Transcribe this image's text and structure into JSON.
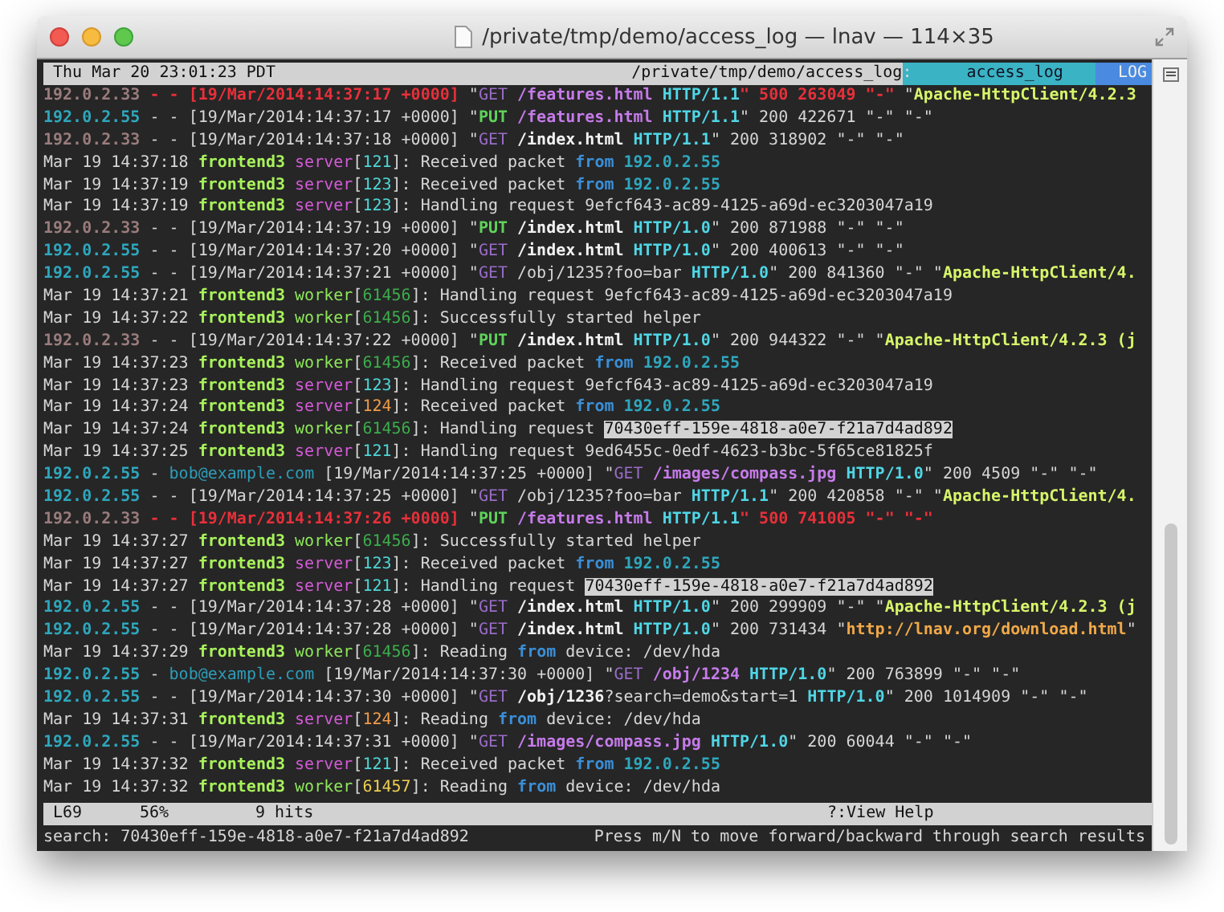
{
  "window": {
    "title": "/private/tmp/demo/access_log — lnav — 114×35"
  },
  "top_bar": {
    "clock": "Thu Mar 20 23:01:23 PDT",
    "path": "/private/tmp/demo/access_log",
    "separator": ":",
    "file": "access_log",
    "view": "LOG"
  },
  "log_lines": [
    [
      {
        "kind": "ip-dim",
        "text": "192.0.2.33"
      },
      {
        "kind": "error",
        "text": " - - [19/Mar/2014:14:37:17 +0000]"
      },
      {
        "kind": "plain",
        "text": " \""
      },
      {
        "kind": "get",
        "text": "GET"
      },
      {
        "kind": "path",
        "text": " /features.html"
      },
      {
        "kind": "proto",
        "text": " HTTP/1.1"
      },
      {
        "kind": "error",
        "text": "\" 500 263049 \"-\" "
      },
      {
        "kind": "plain",
        "text": "\""
      },
      {
        "kind": "agent",
        "text": "Apache-HttpClient/4.2.3"
      }
    ],
    [
      {
        "kind": "ip",
        "text": "192.0.2.55"
      },
      {
        "kind": "plain",
        "text": " - - [19/Mar/2014:14:37:17 +0000] \""
      },
      {
        "kind": "put",
        "text": "PUT"
      },
      {
        "kind": "path",
        "text": " /features.html"
      },
      {
        "kind": "proto",
        "text": " HTTP/1.1"
      },
      {
        "kind": "plain",
        "text": "\" 200 422671 \"-\" \"-\""
      }
    ],
    [
      {
        "kind": "ip-dim",
        "text": "192.0.2.33"
      },
      {
        "kind": "plain",
        "text": " - - [19/Mar/2014:14:37:18 +0000] \""
      },
      {
        "kind": "get",
        "text": "GET"
      },
      {
        "kind": "file",
        "text": " /index.html"
      },
      {
        "kind": "proto",
        "text": " HTTP/1.1"
      },
      {
        "kind": "plain",
        "text": "\" 200 318902 \"-\" \"-\""
      }
    ],
    [
      {
        "kind": "plain",
        "text": "Mar 19 14:37:18 "
      },
      {
        "kind": "host",
        "text": "frontend3"
      },
      {
        "kind": "server",
        "text": " server"
      },
      {
        "kind": "plain",
        "text": "["
      },
      {
        "kind": "pid-cyan",
        "text": "121"
      },
      {
        "kind": "plain",
        "text": "]: Received packet "
      },
      {
        "kind": "from",
        "text": "from"
      },
      {
        "kind": "ip",
        "text": " 192.0.2.55"
      }
    ],
    [
      {
        "kind": "plain",
        "text": "Mar 19 14:37:19 "
      },
      {
        "kind": "host",
        "text": "frontend3"
      },
      {
        "kind": "server",
        "text": " server"
      },
      {
        "kind": "plain",
        "text": "["
      },
      {
        "kind": "pid-cyan",
        "text": "123"
      },
      {
        "kind": "plain",
        "text": "]: Received packet "
      },
      {
        "kind": "from",
        "text": "from"
      },
      {
        "kind": "ip",
        "text": " 192.0.2.55"
      }
    ],
    [
      {
        "kind": "plain",
        "text": "Mar 19 14:37:19 "
      },
      {
        "kind": "host",
        "text": "frontend3"
      },
      {
        "kind": "server",
        "text": " server"
      },
      {
        "kind": "plain",
        "text": "["
      },
      {
        "kind": "pid-cyan",
        "text": "123"
      },
      {
        "kind": "plain",
        "text": "]: Handling request 9efcf643-ac89-4125-a69d-ec3203047a19"
      }
    ],
    [
      {
        "kind": "ip-dim",
        "text": "192.0.2.33"
      },
      {
        "kind": "plain",
        "text": " - - [19/Mar/2014:14:37:19 +0000] \""
      },
      {
        "kind": "put",
        "text": "PUT"
      },
      {
        "kind": "file",
        "text": " /index.html"
      },
      {
        "kind": "proto",
        "text": " HTTP/1.0"
      },
      {
        "kind": "plain",
        "text": "\" 200 871988 \"-\" \"-\""
      }
    ],
    [
      {
        "kind": "ip",
        "text": "192.0.2.55"
      },
      {
        "kind": "plain",
        "text": " - - [19/Mar/2014:14:37:20 +0000] \""
      },
      {
        "kind": "get",
        "text": "GET"
      },
      {
        "kind": "file",
        "text": " /index.html"
      },
      {
        "kind": "proto",
        "text": " HTTP/1.0"
      },
      {
        "kind": "plain",
        "text": "\" 200 400613 \"-\" \"-\""
      }
    ],
    [
      {
        "kind": "ip",
        "text": "192.0.2.55"
      },
      {
        "kind": "plain",
        "text": " - - [19/Mar/2014:14:37:21 +0000] \""
      },
      {
        "kind": "get",
        "text": "GET"
      },
      {
        "kind": "plain",
        "text": " /obj/1235?foo=bar"
      },
      {
        "kind": "proto",
        "text": " HTTP/1.0"
      },
      {
        "kind": "plain",
        "text": "\" 200 841360 \"-\" \""
      },
      {
        "kind": "agent",
        "text": "Apache-HttpClient/4."
      }
    ],
    [
      {
        "kind": "plain",
        "text": "Mar 19 14:37:21 "
      },
      {
        "kind": "host",
        "text": "frontend3"
      },
      {
        "kind": "worker",
        "text": " worker"
      },
      {
        "kind": "plain",
        "text": "["
      },
      {
        "kind": "pid-green",
        "text": "61456"
      },
      {
        "kind": "plain",
        "text": "]: Handling request 9efcf643-ac89-4125-a69d-ec3203047a19"
      }
    ],
    [
      {
        "kind": "plain",
        "text": "Mar 19 14:37:22 "
      },
      {
        "kind": "host",
        "text": "frontend3"
      },
      {
        "kind": "worker",
        "text": " worker"
      },
      {
        "kind": "plain",
        "text": "["
      },
      {
        "kind": "pid-green",
        "text": "61456"
      },
      {
        "kind": "plain",
        "text": "]: Successfully started helper"
      }
    ],
    [
      {
        "kind": "ip-dim",
        "text": "192.0.2.33"
      },
      {
        "kind": "plain",
        "text": " - - [19/Mar/2014:14:37:22 +0000] \""
      },
      {
        "kind": "put",
        "text": "PUT"
      },
      {
        "kind": "file",
        "text": " /index.html"
      },
      {
        "kind": "proto",
        "text": " HTTP/1.0"
      },
      {
        "kind": "plain",
        "text": "\" 200 944322 \"-\" \""
      },
      {
        "kind": "agent",
        "text": "Apache-HttpClient/4.2.3 (j"
      }
    ],
    [
      {
        "kind": "plain",
        "text": "Mar 19 14:37:23 "
      },
      {
        "kind": "host",
        "text": "frontend3"
      },
      {
        "kind": "worker",
        "text": " worker"
      },
      {
        "kind": "plain",
        "text": "["
      },
      {
        "kind": "pid-green",
        "text": "61456"
      },
      {
        "kind": "plain",
        "text": "]: Received packet "
      },
      {
        "kind": "from",
        "text": "from"
      },
      {
        "kind": "ip",
        "text": " 192.0.2.55"
      }
    ],
    [
      {
        "kind": "plain",
        "text": "Mar 19 14:37:23 "
      },
      {
        "kind": "host",
        "text": "frontend3"
      },
      {
        "kind": "server",
        "text": " server"
      },
      {
        "kind": "plain",
        "text": "["
      },
      {
        "kind": "pid-cyan",
        "text": "123"
      },
      {
        "kind": "plain",
        "text": "]: Handling request 9efcf643-ac89-4125-a69d-ec3203047a19"
      }
    ],
    [
      {
        "kind": "plain",
        "text": "Mar 19 14:37:24 "
      },
      {
        "kind": "host",
        "text": "frontend3"
      },
      {
        "kind": "server",
        "text": " server"
      },
      {
        "kind": "plain",
        "text": "["
      },
      {
        "kind": "pid-orange",
        "text": "124"
      },
      {
        "kind": "plain",
        "text": "]: Received packet "
      },
      {
        "kind": "from",
        "text": "from"
      },
      {
        "kind": "ip",
        "text": " 192.0.2.55"
      }
    ],
    [
      {
        "kind": "plain",
        "text": "Mar 19 14:37:24 "
      },
      {
        "kind": "host",
        "text": "frontend3"
      },
      {
        "kind": "worker",
        "text": " worker"
      },
      {
        "kind": "plain",
        "text": "["
      },
      {
        "kind": "pid-green",
        "text": "61456"
      },
      {
        "kind": "plain",
        "text": "]: Handling request "
      },
      {
        "kind": "match",
        "text": "70430eff-159e-4818-a0e7-f21a7d4ad892"
      }
    ],
    [
      {
        "kind": "plain",
        "text": "Mar 19 14:37:25 "
      },
      {
        "kind": "host",
        "text": "frontend3"
      },
      {
        "kind": "server",
        "text": " server"
      },
      {
        "kind": "plain",
        "text": "["
      },
      {
        "kind": "pid-cyan",
        "text": "121"
      },
      {
        "kind": "plain",
        "text": "]: Handling request 9ed6455c-0edf-4623-b3bc-5f65ce81825f"
      }
    ],
    [
      {
        "kind": "ip",
        "text": "192.0.2.55"
      },
      {
        "kind": "plain",
        "text": " - "
      },
      {
        "kind": "user",
        "text": "bob@example.com"
      },
      {
        "kind": "plain",
        "text": " [19/Mar/2014:14:37:25 +0000] \""
      },
      {
        "kind": "get",
        "text": "GET"
      },
      {
        "kind": "path",
        "text": " /images/compass.jpg"
      },
      {
        "kind": "proto",
        "text": " HTTP/1.0"
      },
      {
        "kind": "plain",
        "text": "\" 200 4509 \"-\" \"-\""
      }
    ],
    [
      {
        "kind": "ip",
        "text": "192.0.2.55"
      },
      {
        "kind": "plain",
        "text": " - - [19/Mar/2014:14:37:25 +0000] \""
      },
      {
        "kind": "get",
        "text": "GET"
      },
      {
        "kind": "plain",
        "text": " /obj/1235?foo=bar"
      },
      {
        "kind": "proto",
        "text": " HTTP/1.1"
      },
      {
        "kind": "plain",
        "text": "\" 200 420858 \"-\" \""
      },
      {
        "kind": "agent",
        "text": "Apache-HttpClient/4."
      }
    ],
    [
      {
        "kind": "ip-dim",
        "text": "192.0.2.33"
      },
      {
        "kind": "error",
        "text": " - - [19/Mar/2014:14:37:26 +0000]"
      },
      {
        "kind": "plain",
        "text": " \""
      },
      {
        "kind": "put",
        "text": "PUT"
      },
      {
        "kind": "path",
        "text": " /features.html"
      },
      {
        "kind": "proto",
        "text": " HTTP/1.1"
      },
      {
        "kind": "error",
        "text": "\" 500 741005 \"-\" \"-\""
      }
    ],
    [
      {
        "kind": "plain",
        "text": "Mar 19 14:37:27 "
      },
      {
        "kind": "host",
        "text": "frontend3"
      },
      {
        "kind": "worker",
        "text": " worker"
      },
      {
        "kind": "plain",
        "text": "["
      },
      {
        "kind": "pid-green",
        "text": "61456"
      },
      {
        "kind": "plain",
        "text": "]: Successfully started helper"
      }
    ],
    [
      {
        "kind": "plain",
        "text": "Mar 19 14:37:27 "
      },
      {
        "kind": "host",
        "text": "frontend3"
      },
      {
        "kind": "server",
        "text": " server"
      },
      {
        "kind": "plain",
        "text": "["
      },
      {
        "kind": "pid-cyan",
        "text": "123"
      },
      {
        "kind": "plain",
        "text": "]: Received packet "
      },
      {
        "kind": "from",
        "text": "from"
      },
      {
        "kind": "ip",
        "text": " 192.0.2.55"
      }
    ],
    [
      {
        "kind": "plain",
        "text": "Mar 19 14:37:27 "
      },
      {
        "kind": "host",
        "text": "frontend3"
      },
      {
        "kind": "server",
        "text": " server"
      },
      {
        "kind": "plain",
        "text": "["
      },
      {
        "kind": "pid-cyan",
        "text": "121"
      },
      {
        "kind": "plain",
        "text": "]: Handling request "
      },
      {
        "kind": "match",
        "text": "70430eff-159e-4818-a0e7-f21a7d4ad892"
      }
    ],
    [
      {
        "kind": "ip",
        "text": "192.0.2.55"
      },
      {
        "kind": "plain",
        "text": " - - [19/Mar/2014:14:37:28 +0000] \""
      },
      {
        "kind": "get",
        "text": "GET"
      },
      {
        "kind": "file",
        "text": " /index.html"
      },
      {
        "kind": "proto",
        "text": " HTTP/1.0"
      },
      {
        "kind": "plain",
        "text": "\" 200 299909 \"-\" \""
      },
      {
        "kind": "agent",
        "text": "Apache-HttpClient/4.2.3 (j"
      }
    ],
    [
      {
        "kind": "ip",
        "text": "192.0.2.55"
      },
      {
        "kind": "plain",
        "text": " - - [19/Mar/2014:14:37:28 +0000] \""
      },
      {
        "kind": "get",
        "text": "GET"
      },
      {
        "kind": "file",
        "text": " /index.html"
      },
      {
        "kind": "proto",
        "text": " HTTP/1.0"
      },
      {
        "kind": "plain",
        "text": "\" 200 731434 \""
      },
      {
        "kind": "url",
        "text": "http://lnav.org/download.html"
      },
      {
        "kind": "plain",
        "text": "\""
      }
    ],
    [
      {
        "kind": "plain",
        "text": "Mar 19 14:37:29 "
      },
      {
        "kind": "host",
        "text": "frontend3"
      },
      {
        "kind": "worker",
        "text": " worker"
      },
      {
        "kind": "plain",
        "text": "["
      },
      {
        "kind": "pid-green",
        "text": "61456"
      },
      {
        "kind": "plain",
        "text": "]: Reading "
      },
      {
        "kind": "from",
        "text": "from"
      },
      {
        "kind": "plain",
        "text": " device: /dev/hda"
      }
    ],
    [
      {
        "kind": "ip",
        "text": "192.0.2.55"
      },
      {
        "kind": "plain",
        "text": " - "
      },
      {
        "kind": "user",
        "text": "bob@example.com"
      },
      {
        "kind": "plain",
        "text": " [19/Mar/2014:14:37:30 +0000] \""
      },
      {
        "kind": "get",
        "text": "GET"
      },
      {
        "kind": "path",
        "text": " /obj/1234"
      },
      {
        "kind": "proto",
        "text": " HTTP/1.0"
      },
      {
        "kind": "plain",
        "text": "\" 200 763899 \"-\" \"-\""
      }
    ],
    [
      {
        "kind": "ip",
        "text": "192.0.2.55"
      },
      {
        "kind": "plain",
        "text": " - - [19/Mar/2014:14:37:30 +0000] \""
      },
      {
        "kind": "get",
        "text": "GET"
      },
      {
        "kind": "file",
        "text": " /obj/1236"
      },
      {
        "kind": "plain",
        "text": "?search=demo&start=1"
      },
      {
        "kind": "proto",
        "text": " HTTP/1.0"
      },
      {
        "kind": "plain",
        "text": "\" 200 1014909 \"-\" \"-\""
      }
    ],
    [
      {
        "kind": "plain",
        "text": "Mar 19 14:37:31 "
      },
      {
        "kind": "host",
        "text": "frontend3"
      },
      {
        "kind": "server",
        "text": " server"
      },
      {
        "kind": "plain",
        "text": "["
      },
      {
        "kind": "pid-orange",
        "text": "124"
      },
      {
        "kind": "plain",
        "text": "]: Reading "
      },
      {
        "kind": "from",
        "text": "from"
      },
      {
        "kind": "plain",
        "text": " device: /dev/hda"
      }
    ],
    [
      {
        "kind": "ip",
        "text": "192.0.2.55"
      },
      {
        "kind": "plain",
        "text": " - - [19/Mar/2014:14:37:31 +0000] \""
      },
      {
        "kind": "get",
        "text": "GET"
      },
      {
        "kind": "path",
        "text": " /images/compass.jpg"
      },
      {
        "kind": "proto",
        "text": " HTTP/1.0"
      },
      {
        "kind": "plain",
        "text": "\" 200 60044 \"-\" \"-\""
      }
    ],
    [
      {
        "kind": "plain",
        "text": "Mar 19 14:37:32 "
      },
      {
        "kind": "host",
        "text": "frontend3"
      },
      {
        "kind": "server",
        "text": " server"
      },
      {
        "kind": "plain",
        "text": "["
      },
      {
        "kind": "pid-cyan",
        "text": "121"
      },
      {
        "kind": "plain",
        "text": "]: Received packet "
      },
      {
        "kind": "from",
        "text": "from"
      },
      {
        "kind": "ip",
        "text": " 192.0.2.55"
      }
    ],
    [
      {
        "kind": "plain",
        "text": "Mar 19 14:37:32 "
      },
      {
        "kind": "host",
        "text": "frontend3"
      },
      {
        "kind": "worker",
        "text": " worker"
      },
      {
        "kind": "plain",
        "text": "["
      },
      {
        "kind": "pid-yellow",
        "text": "61457"
      },
      {
        "kind": "plain",
        "text": "]: Reading "
      },
      {
        "kind": "from",
        "text": "from"
      },
      {
        "kind": "plain",
        "text": " device: /dev/hda"
      }
    ]
  ],
  "status_bar": {
    "line": "L69",
    "percent": "56%",
    "hits": "9 hits",
    "help": "?:View Help"
  },
  "prompt": {
    "query": "search: 70430eff-159e-4818-a0e7-f21a7d4ad892",
    "hint": "Press m/N to move forward/backward through search results"
  }
}
